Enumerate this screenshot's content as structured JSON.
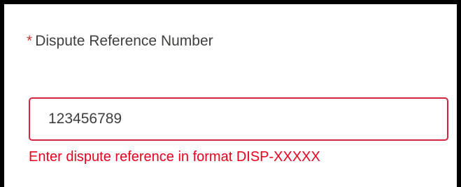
{
  "field": {
    "required_mark": "*",
    "label": "Dispute Reference Number",
    "value": "123456789",
    "error": "Enter dispute reference in format DISP-XXXXX"
  },
  "colors": {
    "border_frame": "#000000",
    "error_red": "#ea001e",
    "input_border": "#d4253f",
    "required_red": "#c23934",
    "text": "#3e3e3c"
  }
}
